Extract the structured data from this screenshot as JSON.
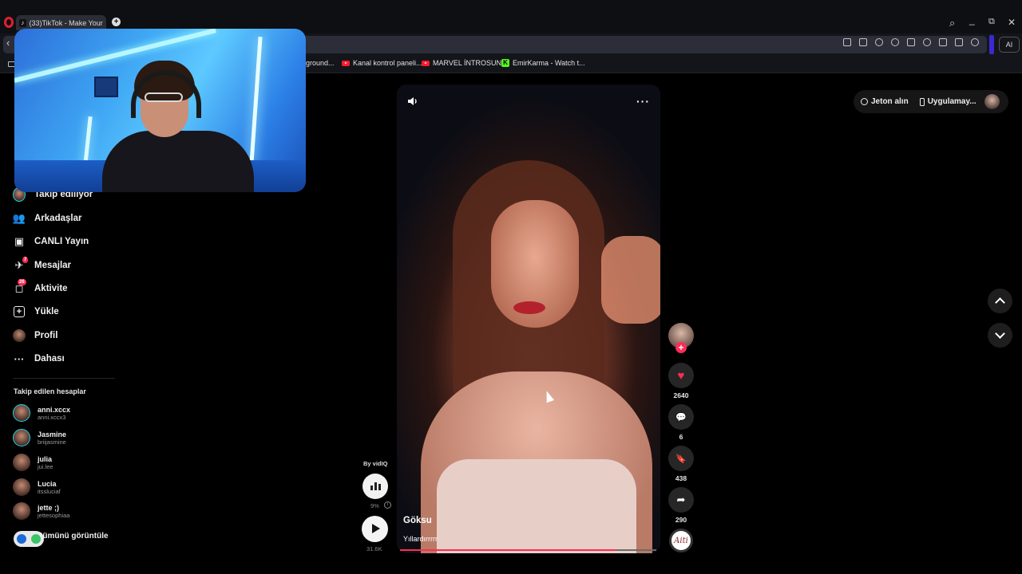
{
  "browser": {
    "tab_title": "(33)TikTok - Make Your D...",
    "new_tab": "+",
    "minimize": "_",
    "restore": "⧉",
    "close": "✕",
    "search": "⌕",
    "back": "‹",
    "ai_label": "AI",
    "bookmarks": [
      {
        "label": "ground...",
        "icon": "none"
      },
      {
        "label": "Kanal kontrol paneli...",
        "icon": "youtube-icon"
      },
      {
        "label": "MARVEL İNTROSUN...",
        "icon": "youtube-icon"
      },
      {
        "label": "EmirKarma - Watch t...",
        "icon": "kick-icon"
      }
    ],
    "kick_glyph": "K"
  },
  "sidebar": {
    "items": [
      {
        "label": "Takip ediliyor",
        "icon": "following-icon"
      },
      {
        "label": "Arkadaşlar",
        "icon": "friends-icon",
        "glyph": "👥"
      },
      {
        "label": "CANLI Yayın",
        "icon": "live-icon",
        "glyph": "▣"
      },
      {
        "label": "Mesajlar",
        "icon": "messages-icon",
        "glyph": "✈",
        "badge": "7"
      },
      {
        "label": "Aktivite",
        "icon": "activity-icon",
        "glyph": "◻",
        "badge": "26"
      },
      {
        "label": "Yükle",
        "icon": "upload-icon",
        "glyph": "+"
      },
      {
        "label": "Profil",
        "icon": "profile-icon"
      },
      {
        "label": "Dahası",
        "icon": "more-icon",
        "glyph": "···"
      }
    ],
    "following_heading": "Takip edilen hesaplar",
    "accounts": [
      {
        "name": "anni.xccx",
        "handle": "anni.xccx3"
      },
      {
        "name": "Jasmine",
        "handle": "briijasmine"
      },
      {
        "name": "julia",
        "handle": "jui.lee"
      },
      {
        "name": "Lucia",
        "handle": "itssluciaf"
      },
      {
        "name": "jette ;)",
        "handle": "jettesophiaa"
      }
    ],
    "see_all": "tümünü görüntüle"
  },
  "top_actions": {
    "coins": "Jeton alın",
    "app": "Uygulamay..."
  },
  "video": {
    "author": "Göksu",
    "caption": "Yıllardırrrrr",
    "more": "···",
    "progress": 0.84,
    "actions": {
      "follow": "+",
      "like_glyph": "♥",
      "like_count": "2640",
      "comment_glyph": "💬",
      "comment_count": "6",
      "save_glyph": "🔖",
      "save_count": "438",
      "share_glyph": "➦",
      "share_count": "290",
      "sound_disc": "Aiti"
    }
  },
  "vidiq": {
    "label": "By vidIQ",
    "percent": "9%",
    "info": "i",
    "play_count": "31.6K"
  },
  "colors": {
    "accent": "#fe2c55",
    "background": "#000000",
    "live_ring": "#20d5ec"
  }
}
